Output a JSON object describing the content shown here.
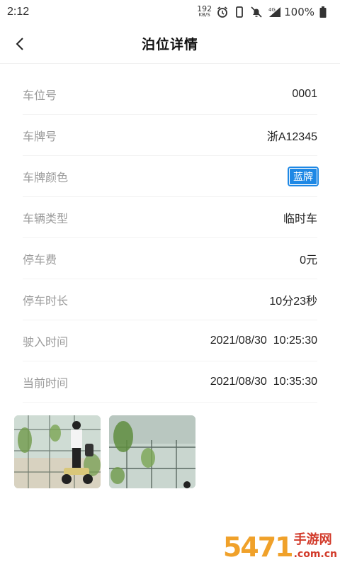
{
  "status_bar": {
    "time": "2:12",
    "net_speed_value": "192",
    "net_speed_unit": "KB/S",
    "network_type": "4G",
    "battery": "100%"
  },
  "header": {
    "title": "泊位详情"
  },
  "details": [
    {
      "label": "车位号",
      "value": "0001"
    },
    {
      "label": "车牌号",
      "value": "浙A12345"
    },
    {
      "label": "车牌颜色",
      "value": "蓝牌"
    },
    {
      "label": "车辆类型",
      "value": "临时车"
    },
    {
      "label": "停车费",
      "value": "0元"
    },
    {
      "label": "停车时长",
      "value": "10分23秒"
    },
    {
      "label": "驶入时间",
      "value": "2021/08/30  10:25:30"
    },
    {
      "label": "当前时间",
      "value": "2021/08/30  10:35:30"
    }
  ],
  "colors": {
    "plate_badge": "#1e88e5",
    "label_text": "#9a9a9a"
  },
  "watermark": {
    "number": "5471",
    "cn": "手游网",
    "en": ".com.cn"
  }
}
